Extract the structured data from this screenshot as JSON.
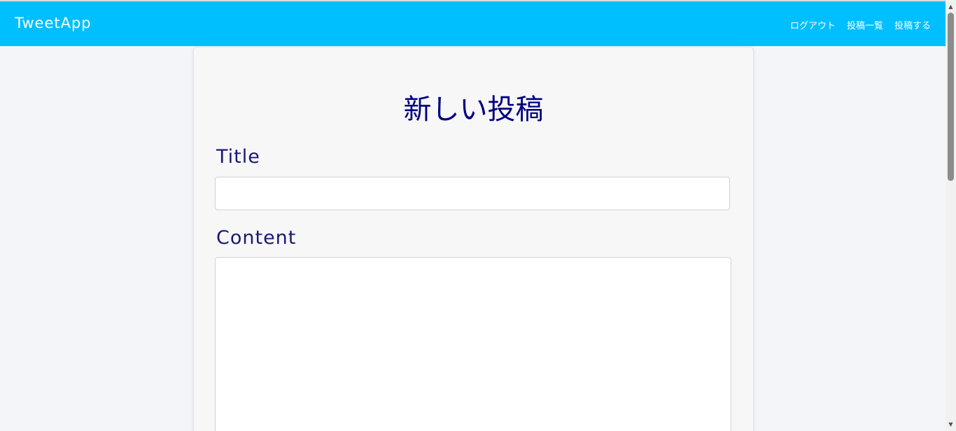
{
  "header": {
    "brand": "TweetApp",
    "nav": [
      "ログアウト",
      "投稿一覧",
      "投稿する"
    ]
  },
  "form": {
    "heading": "新しい投稿",
    "title_label": "Title",
    "title_value": "",
    "content_label": "Content",
    "content_value": ""
  },
  "colors": {
    "navbar": "#00bfff",
    "heading": "#000080",
    "labels": "#191970",
    "page_background": "#f3f5f8"
  },
  "icons": {
    "scroll_up": "up-arrow-icon",
    "scroll_down": "down-arrow-icon"
  }
}
